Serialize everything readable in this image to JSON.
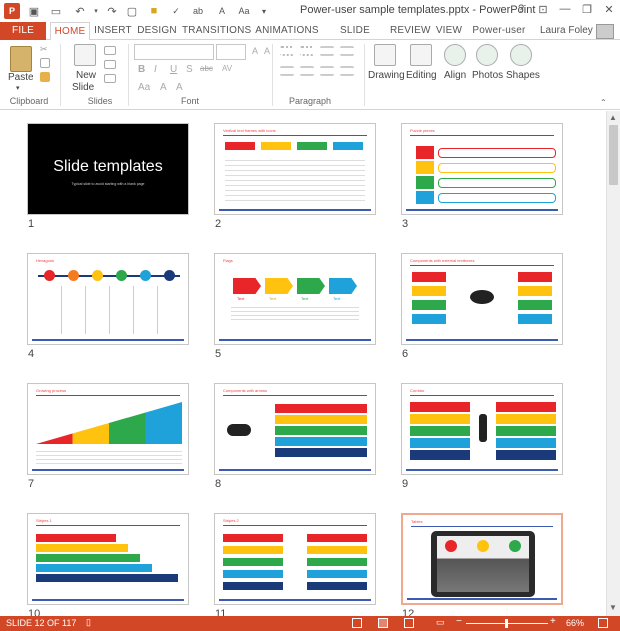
{
  "window": {
    "title": "Power-user sample templates.pptx - PowerPoint",
    "help": "?",
    "minimize": "—",
    "restore": "❐",
    "close": "✕"
  },
  "user": {
    "name": "Laura Foley"
  },
  "tabs": [
    "FILE",
    "HOME",
    "INSERT",
    "DESIGN",
    "TRANSITIONS",
    "ANIMATIONS",
    "SLIDE SHOW",
    "REVIEW",
    "VIEW",
    "Power-user"
  ],
  "ribbon": {
    "paste": "Paste",
    "new_slide": "New",
    "new_slide2": "Slide",
    "drawing": "Drawing",
    "editing": "Editing",
    "align": "Align",
    "photos": "Photos",
    "shapes": "Shapes",
    "groups": [
      "Clipboard",
      "Slides",
      "Font",
      "Paragraph"
    ],
    "font_letters": [
      "B",
      "I",
      "U",
      "S",
      "abc",
      "AV",
      "A",
      "Aa",
      "A",
      "A",
      "A"
    ]
  },
  "slides": [
    {
      "num": "1",
      "title": "Slide templates",
      "subtitle": "Typical slide to avoid starting with a blank page"
    },
    {
      "num": "2",
      "title": "Vertical text frames with icons"
    },
    {
      "num": "3",
      "title": "Puzzle pieces"
    },
    {
      "num": "4",
      "title": "Hexagons"
    },
    {
      "num": "5",
      "title": "Flags"
    },
    {
      "num": "6",
      "title": "Components with external textboxes"
    },
    {
      "num": "7",
      "title": "Growing process"
    },
    {
      "num": "8",
      "title": "Components with arrows"
    },
    {
      "num": "9",
      "title": "Corridor"
    },
    {
      "num": "10",
      "title": "Stripes 1"
    },
    {
      "num": "11",
      "title": "Stripes 2"
    },
    {
      "num": "12",
      "title": "Tables"
    }
  ],
  "flags": {
    "labels": [
      "Text",
      "Text",
      "Text",
      "Text"
    ]
  },
  "status": {
    "slide": "SLIDE 12 OF 117",
    "zoom": "66%"
  },
  "colors": {
    "accent": "#d24726",
    "red": "#e8262a",
    "yellow": "#ffc20e",
    "green": "#2da84a",
    "blue": "#1ea2d9",
    "navy": "#1b3a7a"
  }
}
